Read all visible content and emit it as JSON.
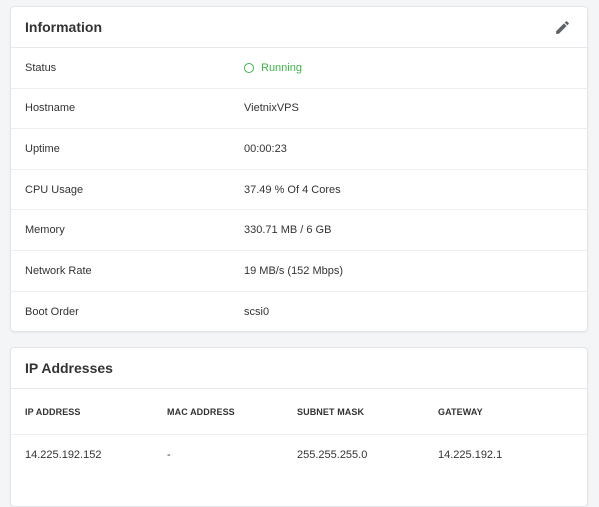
{
  "information": {
    "title": "Information",
    "rows": [
      {
        "label": "Status",
        "value": "Running"
      },
      {
        "label": "Hostname",
        "value": "VietnixVPS"
      },
      {
        "label": "Uptime",
        "value": "00:00:23"
      },
      {
        "label": "CPU Usage",
        "value": "37.49 % Of 4 Cores"
      },
      {
        "label": "Memory",
        "value": "330.71 MB / 6 GB"
      },
      {
        "label": "Network Rate",
        "value": "19 MB/s (152 Mbps)"
      },
      {
        "label": "Boot Order",
        "value": "scsi0"
      }
    ],
    "edit_icon": "pencil-icon",
    "status_color": "#3bb54a"
  },
  "ip_addresses": {
    "title": "IP Addresses",
    "columns": [
      "IP ADDRESS",
      "MAC ADDRESS",
      "SUBNET MASK",
      "GATEWAY"
    ],
    "rows": [
      {
        "ip": "14.225.192.152",
        "mac": "-",
        "subnet": "255.255.255.0",
        "gateway": "14.225.192.1"
      }
    ]
  }
}
